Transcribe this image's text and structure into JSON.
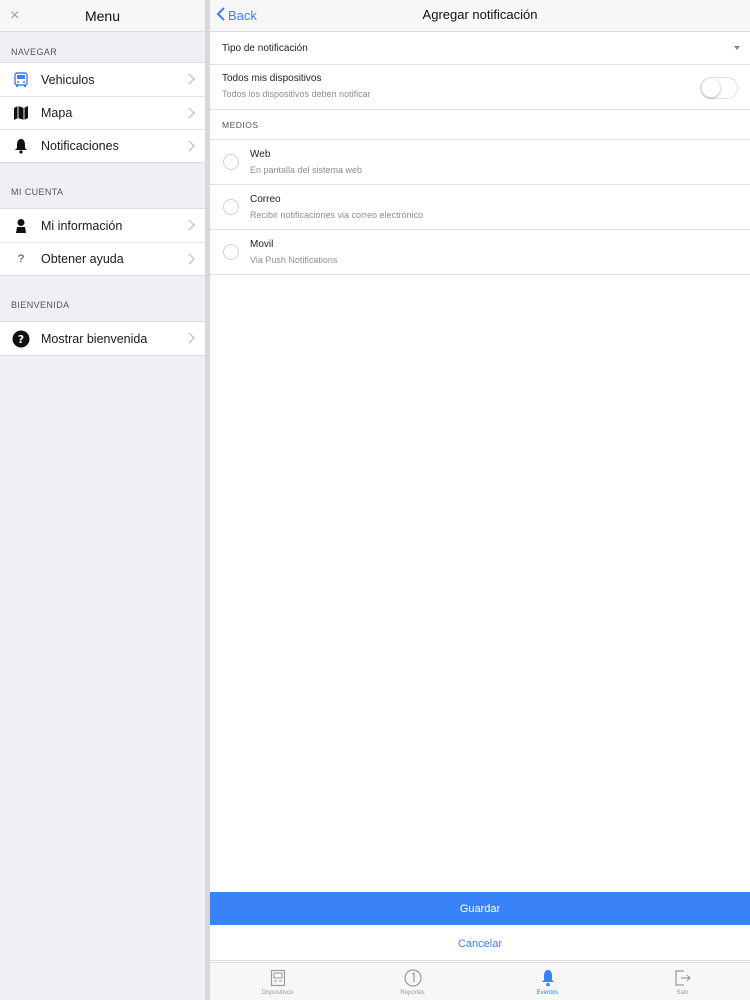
{
  "menu": {
    "close_glyph": "×",
    "title": "Menu",
    "sections": [
      {
        "label": "NAVEGAR",
        "items": [
          {
            "label": "Vehiculos",
            "icon": "bus-icon"
          },
          {
            "label": "Mapa",
            "icon": "map-icon"
          },
          {
            "label": "Notificaciones",
            "icon": "bell-icon"
          }
        ]
      },
      {
        "label": "MI CUENTA",
        "items": [
          {
            "label": "Mi información",
            "icon": "person-icon"
          },
          {
            "label": "Obtener ayuda",
            "icon": "question-icon"
          }
        ]
      },
      {
        "label": "BIENVENIDA",
        "items": [
          {
            "label": "Mostrar bienvenida",
            "icon": "help-circle-icon"
          }
        ]
      }
    ]
  },
  "header": {
    "back_label": "Back",
    "title": "Agregar notificación"
  },
  "form": {
    "type_label": "Tipo de notificación",
    "all_devices": {
      "title": "Todos mis dispositivos",
      "subtitle": "Todos los dispositivos deben notificar",
      "enabled": false
    },
    "medios_label": "MEDIOS",
    "channels": [
      {
        "title": "Web",
        "subtitle": "En pantalla del sistema web",
        "selected": false
      },
      {
        "title": "Correo",
        "subtitle": "Recibir notificaciones via correo electrónico",
        "selected": false
      },
      {
        "title": "Movil",
        "subtitle": "Via Push Notifications",
        "selected": false
      }
    ]
  },
  "actions": {
    "save_label": "Guardar",
    "cancel_label": "Cancelar"
  },
  "tabs": [
    {
      "label": "Dispositivos",
      "icon": "devices-icon",
      "active": false
    },
    {
      "label": "Reportes",
      "icon": "reports-icon",
      "active": false
    },
    {
      "label": "Eventos",
      "icon": "bell-icon",
      "active": true
    },
    {
      "label": "Salir",
      "icon": "logout-icon",
      "active": false
    }
  ],
  "colors": {
    "accent": "#3a82f7",
    "menu_background": "#efeff4",
    "bus_icon": "#3a82f7"
  }
}
